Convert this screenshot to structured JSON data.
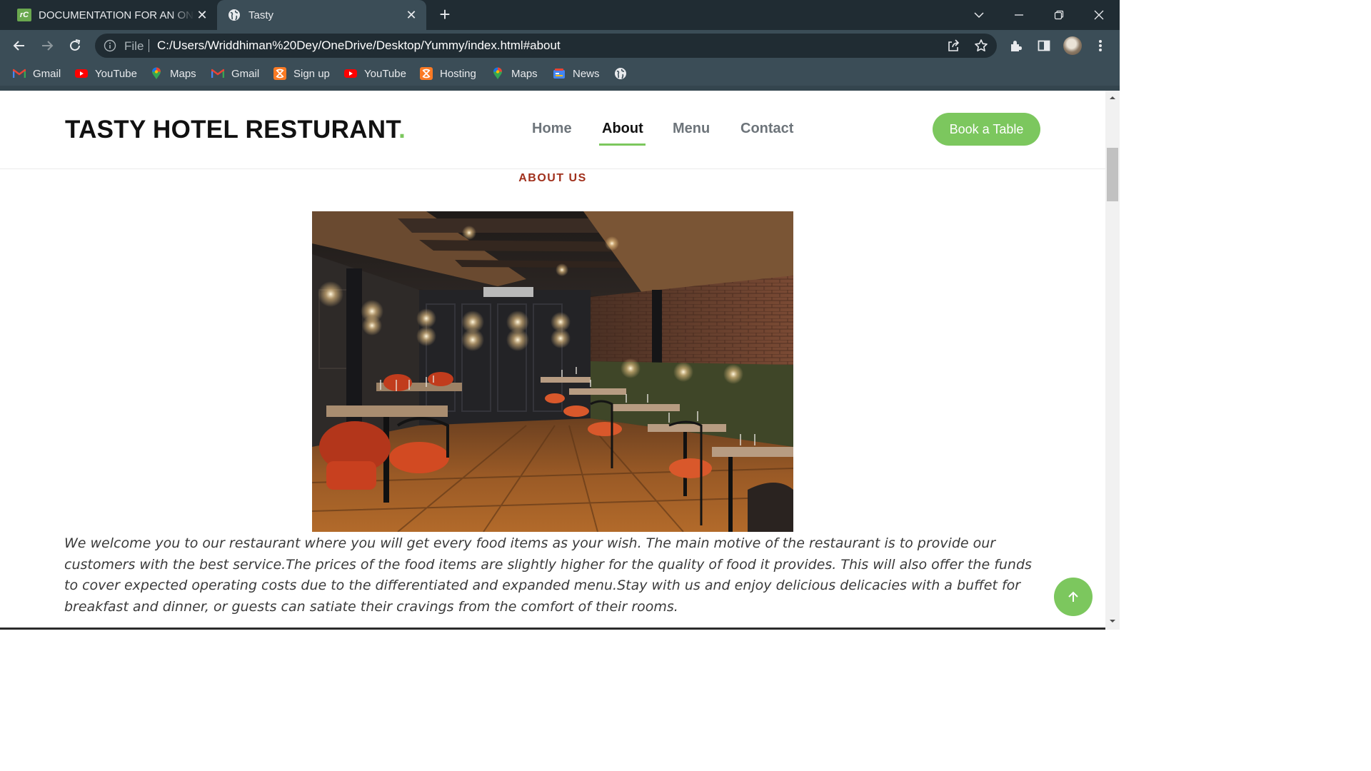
{
  "browser": {
    "tabs": [
      {
        "title": "DOCUMENTATION FOR AN ONLINE",
        "favicon_text": "rC",
        "active": false
      },
      {
        "title": "Tasty",
        "active": true
      }
    ],
    "address": {
      "scheme_label": "File",
      "url": "C:/Users/Wriddhiman%20Dey/OneDrive/Desktop/Yummy/index.html#about"
    },
    "bookmarks": [
      {
        "label": "Gmail",
        "icon": "gmail-icon"
      },
      {
        "label": "YouTube",
        "icon": "youtube-icon"
      },
      {
        "label": "Maps",
        "icon": "maps-icon"
      },
      {
        "label": "Gmail",
        "icon": "gmail-icon"
      },
      {
        "label": "Sign up",
        "icon": "xampp-icon"
      },
      {
        "label": "YouTube",
        "icon": "youtube-icon"
      },
      {
        "label": "Hosting",
        "icon": "xampp-icon"
      },
      {
        "label": "Maps",
        "icon": "maps-icon"
      },
      {
        "label": "News",
        "icon": "news-icon"
      },
      {
        "label": "",
        "icon": "globe-icon"
      }
    ]
  },
  "site": {
    "logo_text": "TASTY HOTEL RESTURANT",
    "logo_dot": ".",
    "nav": [
      {
        "label": "Home",
        "active": false
      },
      {
        "label": "About",
        "active": true
      },
      {
        "label": "Menu",
        "active": false
      },
      {
        "label": "Contact",
        "active": false
      }
    ],
    "cta_label": "Book a Table",
    "section_label": "ABOUT US",
    "about_text": "We welcome you to our restaurant where you will get every food items as your wish. The main motive of the restaurant is to provide our customers with the best service.The prices of the food items are slightly higher for the quality of food it provides. This will also offer the funds to cover expected operating costs due to the differentiated and expanded menu.Stay with us and enjoy delicious delicacies with a buffet for breakfast and dinner, or guests can satiate their cravings from the comfort of their rooms."
  },
  "colors": {
    "accent": "#7cc75e",
    "section_label": "#a0301c",
    "chrome_dark": "#202c33",
    "chrome": "#3b4d57"
  }
}
